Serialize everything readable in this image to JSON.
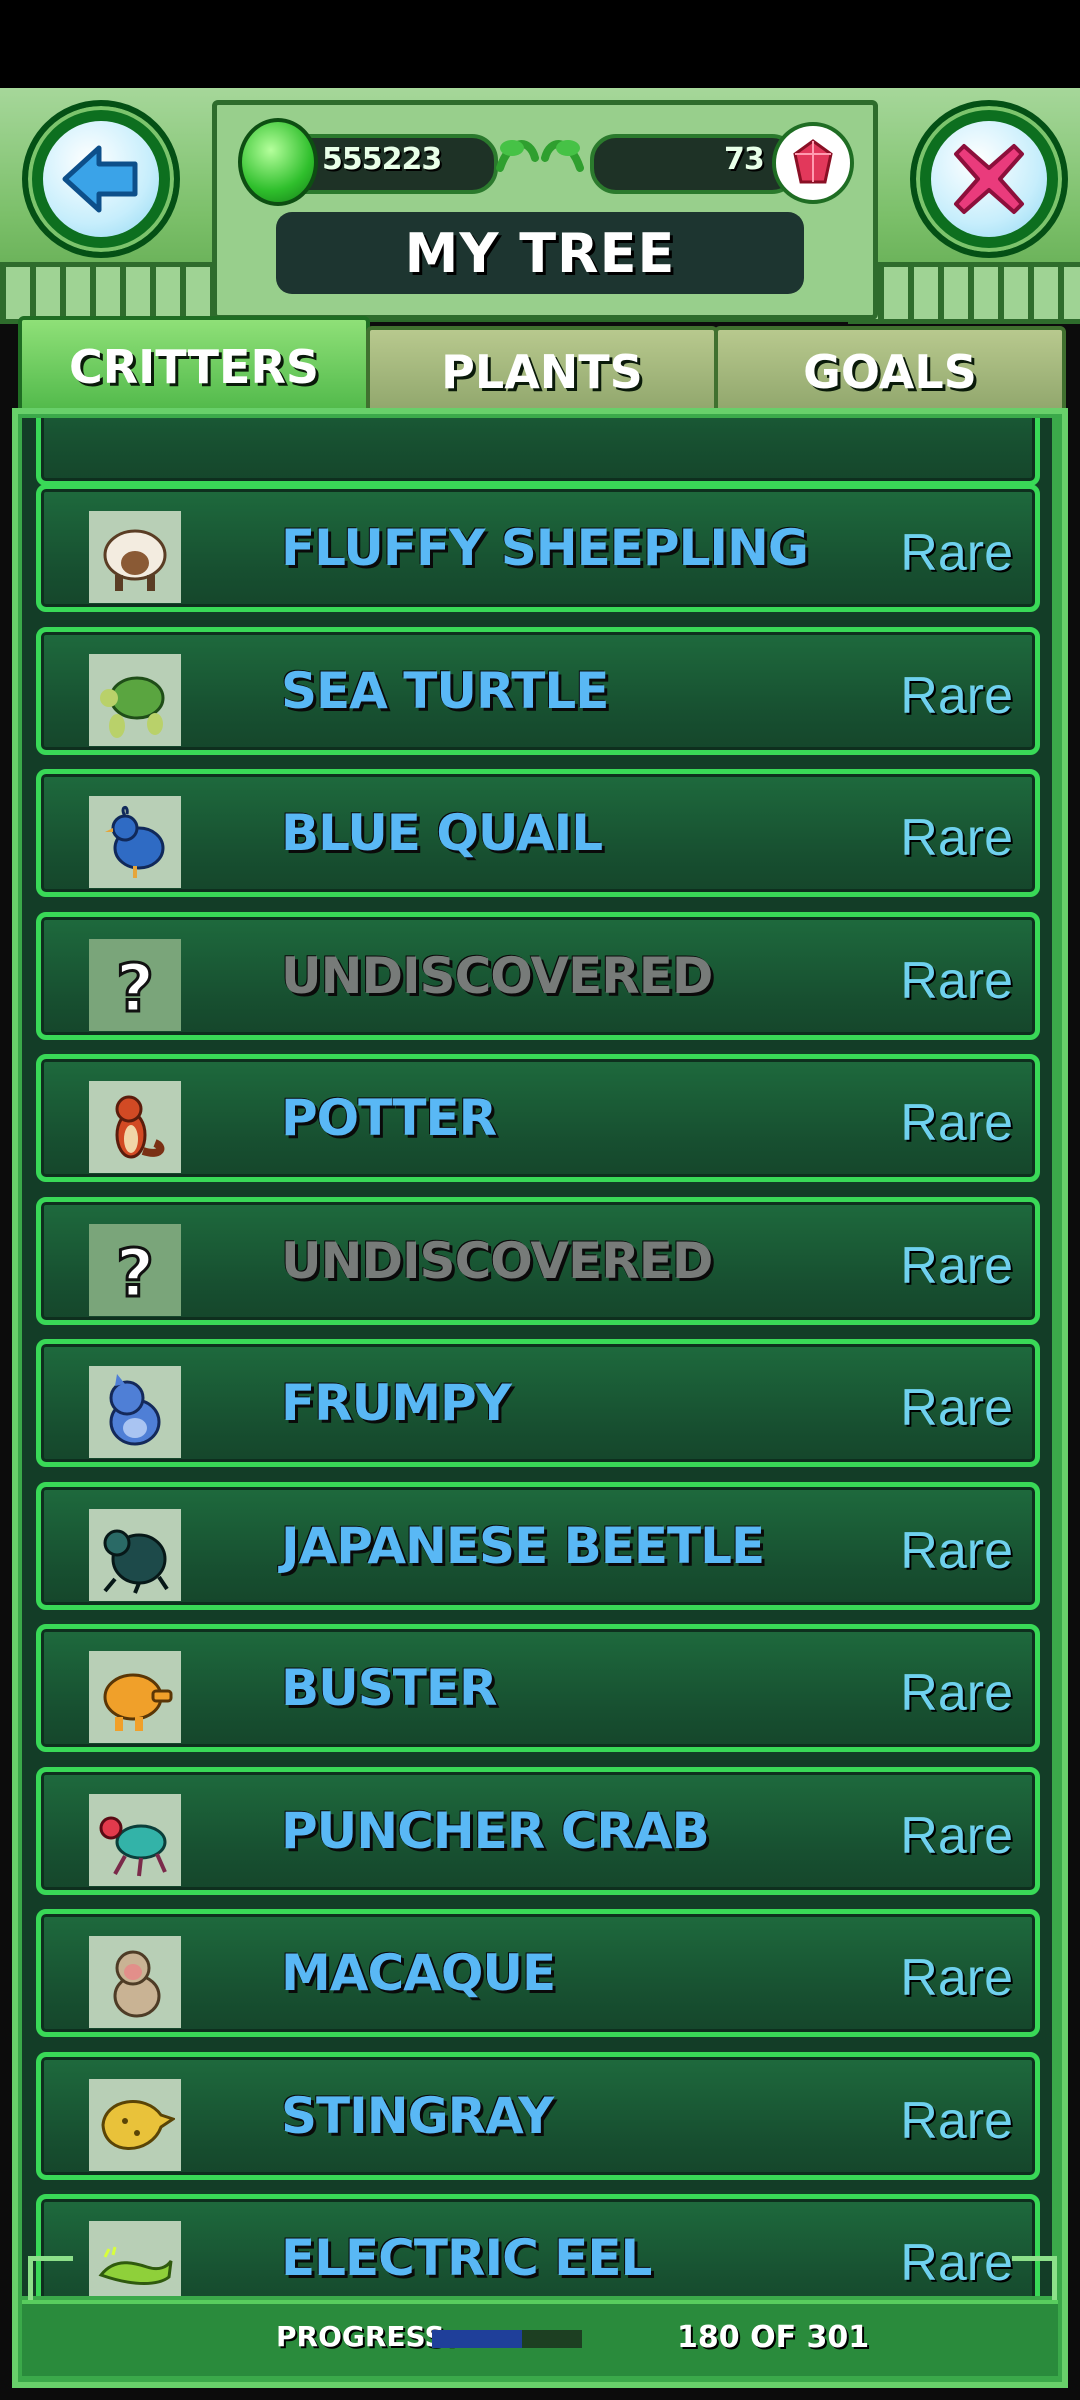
{
  "header": {
    "title": "MY TREE",
    "coins": "555223",
    "gems": "73",
    "back_icon": "back-arrow-icon",
    "close_icon": "close-x-icon"
  },
  "tabs": [
    {
      "label": "CRITTERS",
      "active": true
    },
    {
      "label": "PLANTS",
      "active": false
    },
    {
      "label": "GOALS",
      "active": false
    }
  ],
  "critters": [
    {
      "name": "FLUFFY SHEEPLING",
      "rarity": "Rare",
      "discovered": true,
      "icon": "sheep-icon"
    },
    {
      "name": "SEA TURTLE",
      "rarity": "Rare",
      "discovered": true,
      "icon": "turtle-icon"
    },
    {
      "name": "BLUE QUAIL",
      "rarity": "Rare",
      "discovered": true,
      "icon": "quail-icon"
    },
    {
      "name": "UNDISCOVERED",
      "rarity": "Rare",
      "discovered": false,
      "icon": "question-icon"
    },
    {
      "name": "POTTER",
      "rarity": "Rare",
      "discovered": true,
      "icon": "otter-icon"
    },
    {
      "name": "UNDISCOVERED",
      "rarity": "Rare",
      "discovered": false,
      "icon": "question-icon"
    },
    {
      "name": "FRUMPY",
      "rarity": "Rare",
      "discovered": true,
      "icon": "frumpy-icon"
    },
    {
      "name": "JAPANESE BEETLE",
      "rarity": "Rare",
      "discovered": true,
      "icon": "beetle-icon"
    },
    {
      "name": "BUSTER",
      "rarity": "Rare",
      "discovered": true,
      "icon": "buster-icon"
    },
    {
      "name": "PUNCHER CRAB",
      "rarity": "Rare",
      "discovered": true,
      "icon": "crab-icon"
    },
    {
      "name": "MACAQUE",
      "rarity": "Rare",
      "discovered": true,
      "icon": "monkey-icon"
    },
    {
      "name": "STINGRAY",
      "rarity": "Rare",
      "discovered": true,
      "icon": "stingray-icon"
    },
    {
      "name": "ELECTRIC EEL",
      "rarity": "Rare",
      "discovered": true,
      "icon": "eel-icon"
    }
  ],
  "footer": {
    "progress_label": "PROGRESS:",
    "progress_count": "180 OF 301",
    "progress_fraction": 0.598
  },
  "colors": {
    "name_discovered": "#59b8f5",
    "name_undiscovered": "#777b79",
    "rarity": "#6fd1ee",
    "row_border": "#39d957"
  }
}
